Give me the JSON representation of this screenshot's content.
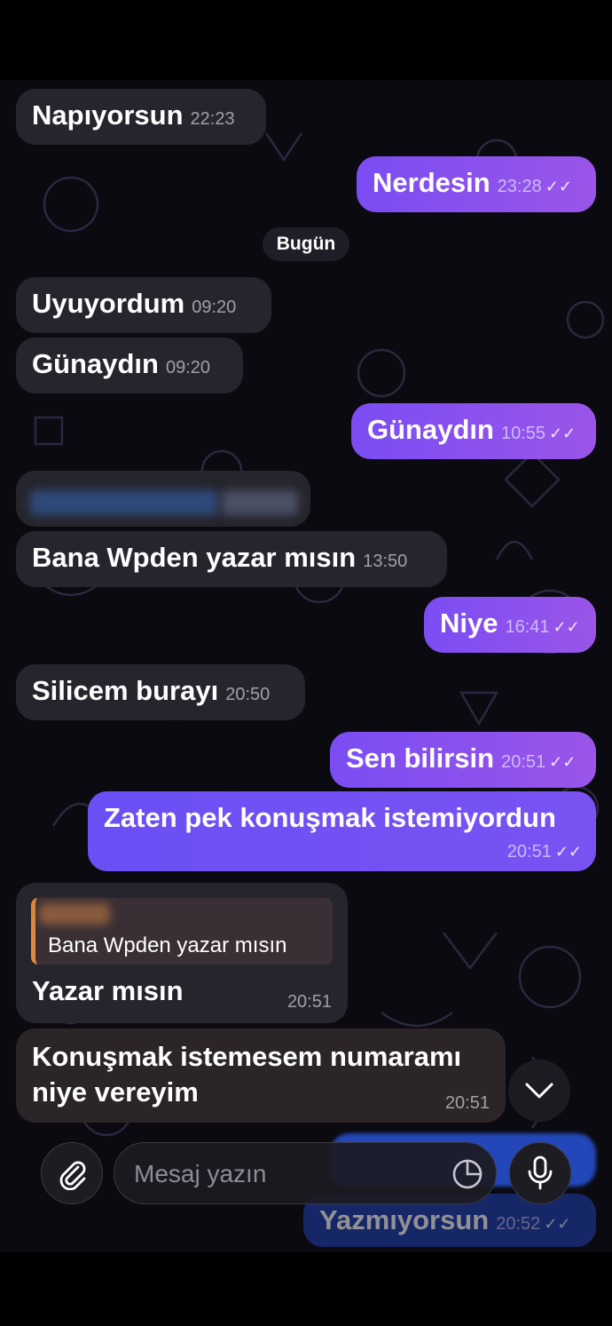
{
  "messages": [
    {
      "id": "m1",
      "dir": "in",
      "text": "Napıyorsun",
      "time": "22:23"
    },
    {
      "id": "m2",
      "dir": "out",
      "text": "Nerdesin",
      "time": "23:28"
    },
    {
      "id": "m3",
      "dir": "in",
      "text": "Uyuyordum",
      "time": "09:20"
    },
    {
      "id": "m4",
      "dir": "in",
      "text": "Günaydın",
      "time": "09:20"
    },
    {
      "id": "m5",
      "dir": "out",
      "text": "Günaydın",
      "time": "10:55"
    },
    {
      "id": "m6",
      "dir": "in",
      "text": "Bana Wpden yazar mısın",
      "time": "13:50"
    },
    {
      "id": "m7",
      "dir": "out",
      "text": "Niye",
      "time": "16:41"
    },
    {
      "id": "m8",
      "dir": "in",
      "text": "Silicem burayı",
      "time": "20:50"
    },
    {
      "id": "m9",
      "dir": "out",
      "text": "Sen bilirsin",
      "time": "20:51"
    },
    {
      "id": "m10",
      "dir": "out",
      "text": "Zaten pek konuşmak istemiyordun",
      "time": "20:51"
    },
    {
      "id": "m11",
      "dir": "in",
      "text": "Yazar mısın",
      "time": "20:51",
      "reply_to": "Bana Wpden yazar mısın"
    },
    {
      "id": "m12",
      "dir": "in",
      "text_line1": "Konuşmak istemesem numaramı",
      "text_line2": "niye vereyim",
      "time": "20:51"
    },
    {
      "id": "m13",
      "dir": "out",
      "text": "Yazmıyorsun",
      "time": "20:52"
    }
  ],
  "day_separator": "Bugün",
  "ticks": "✓✓",
  "composer": {
    "placeholder": "Mesaj yazın"
  },
  "icons": {
    "attach": "paperclip-icon",
    "sticker": "sticker-icon",
    "mic": "microphone-icon",
    "scroll": "chevron-down-icon"
  },
  "colors": {
    "incoming": "#26252d",
    "outgoing": "#8a50ee",
    "accent_quote": "#e08a3c"
  }
}
